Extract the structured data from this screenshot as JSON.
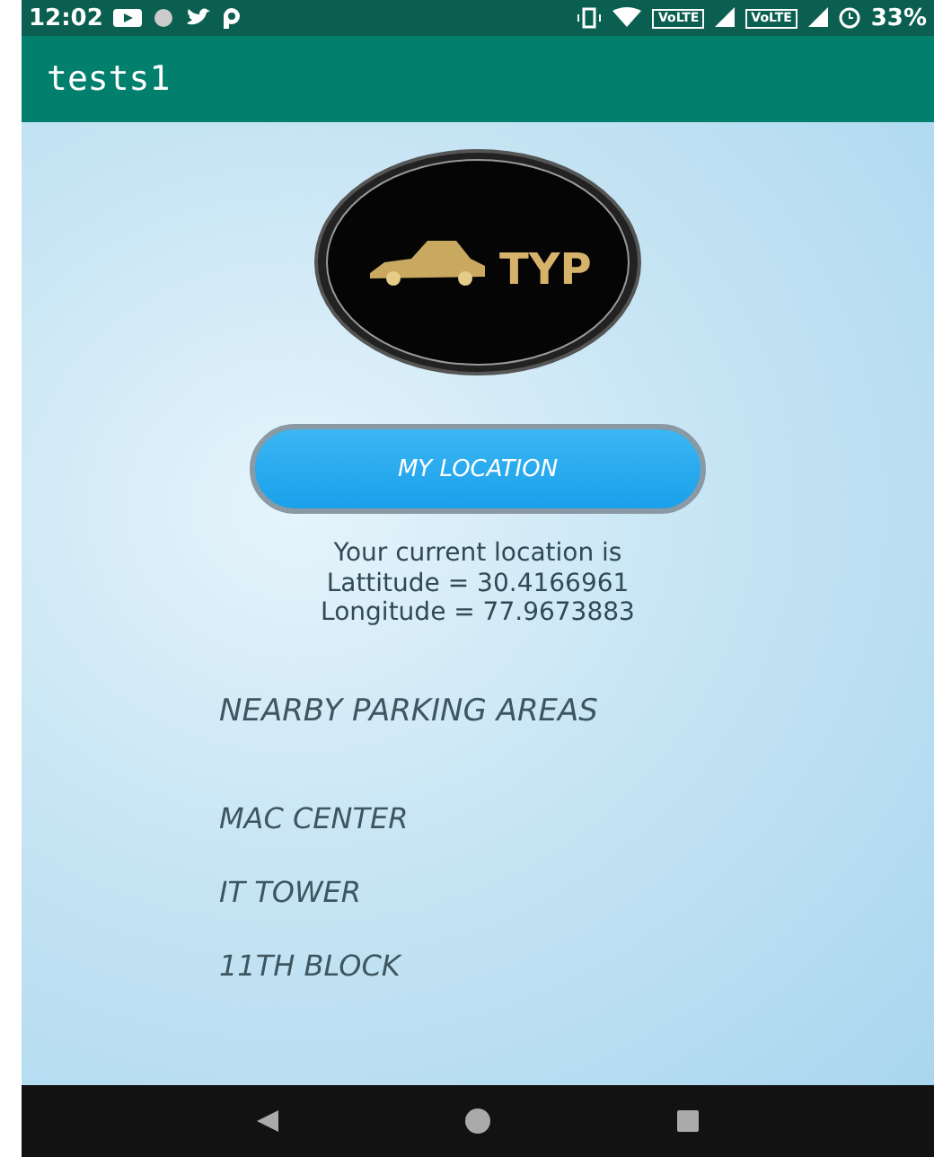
{
  "status_bar": {
    "time": "12:02",
    "network_labels": [
      "VoLTE",
      "VoLTE"
    ],
    "battery": "33%"
  },
  "app_bar": {
    "title": "tests1"
  },
  "logo": {
    "text": "TYP"
  },
  "location_button": {
    "label": "MY LOCATION"
  },
  "location_info": [
    "Your current location is",
    "Lattitude = 30.4166961",
    "Longitude = 77.9673883"
  ],
  "nearby": {
    "heading": "NEARBY PARKING AREAS",
    "items": [
      "MAC CENTER",
      "IT TOWER",
      "11TH BLOCK"
    ]
  }
}
